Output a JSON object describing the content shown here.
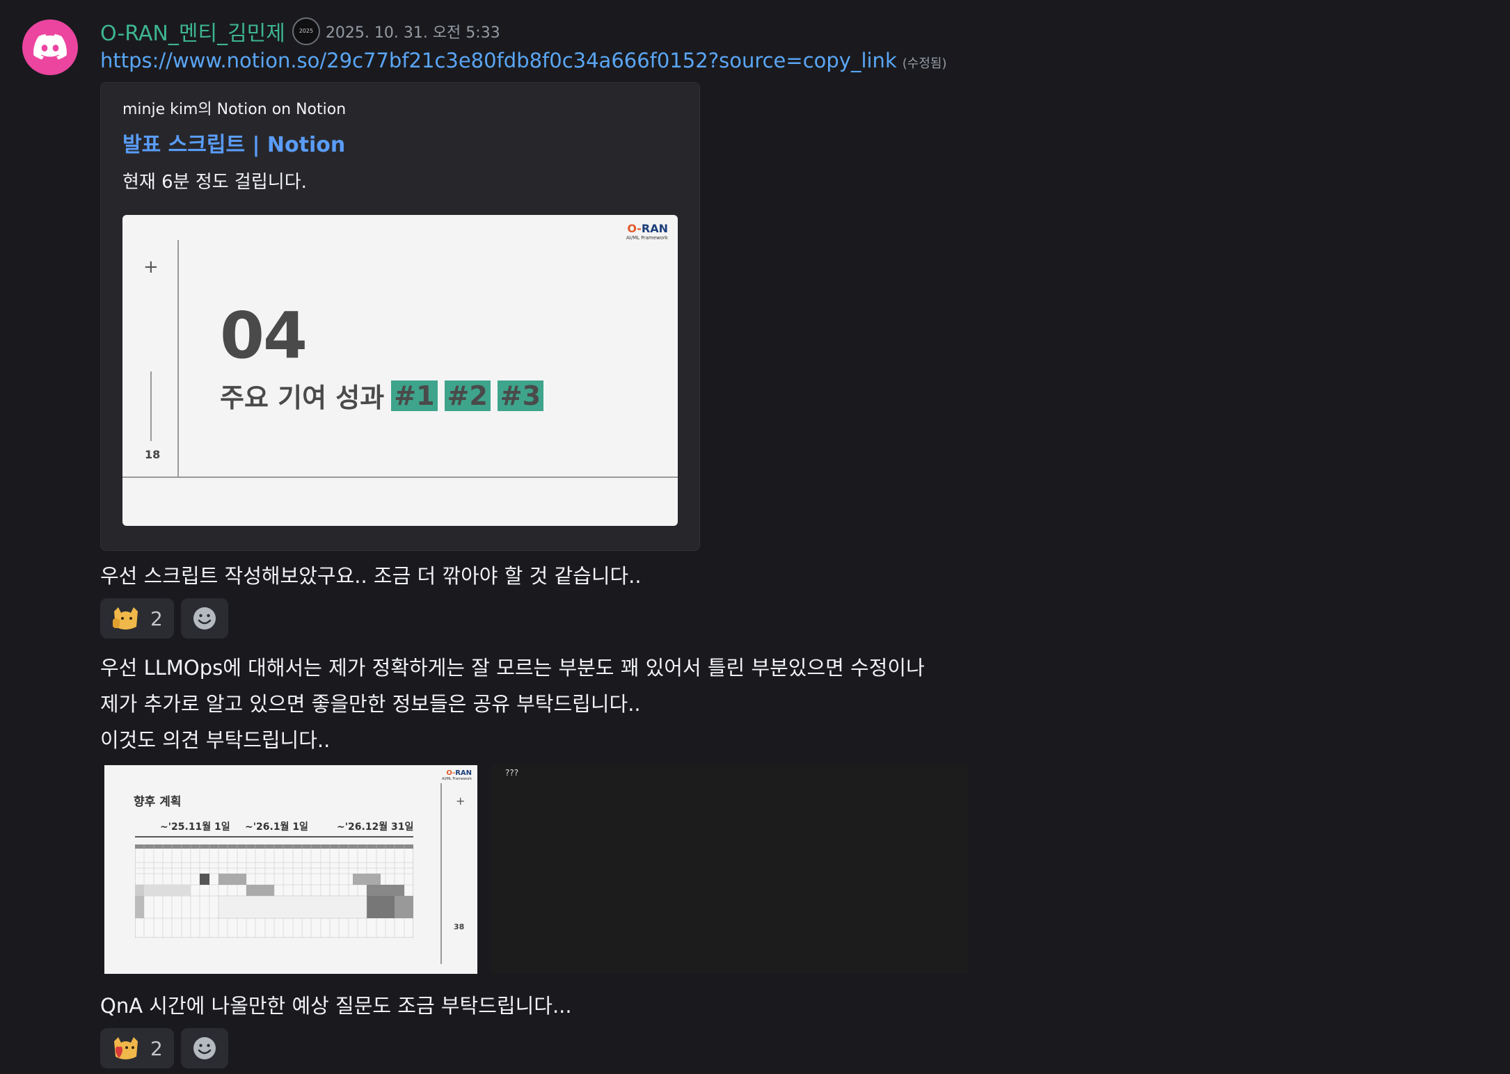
{
  "message": {
    "username": "O-RAN_멘티_김민제",
    "role_badge": "2025",
    "timestamp": "2025. 10. 31. 오전 5:33",
    "link": "https://www.notion.so/29c77bf21c3e80fdb8f0c34a666f0152?source=copy_link",
    "edited_label": "(수정됨)",
    "embed": {
      "provider": "minje kim의 Notion on Notion",
      "title": "발표 스크립트 | Notion",
      "description": "현재 6분 정도 걸립니다.",
      "slide": {
        "logo_main": "RAN",
        "logo_o": "O-",
        "logo_sub": "AI/ML Framework",
        "number": "04",
        "subtitle": "주요 기여 성과",
        "tags": [
          "#1",
          "#2",
          "#3"
        ],
        "page": "18",
        "plus": "+"
      }
    },
    "line1": "우선 스크립트 작성해보았구요.. 조금 더 깎아야 할 것 같습니다..",
    "reaction1": {
      "emoji": "cat-emoji",
      "count": "2"
    },
    "line2": "우선 LLMOps에 대해서는 제가 정확하게는 잘 모르는 부분도 꽤 있어서 틀린 부분있으면 수정이나",
    "line3": "제가 추가로 알고 있으면 좋을만한 정보들은 공유 부탁드립니다..",
    "line4": "이것도 의견 부탁드립니다..",
    "attachment": {
      "title": "향후 계획",
      "phases": [
        "~'25.11월 1일",
        "~'26.1월 1일",
        "~'26.12월 31일"
      ],
      "page": "38",
      "plus": "+",
      "logo_main": "RAN",
      "logo_o": "O-",
      "logo_sub": "AI/ML Framework",
      "second_label": "???"
    },
    "line5": "QnA 시간에 나올만한 예상 질문도 조금 부탁드립니다...",
    "reaction2": {
      "emoji": "heart-cat-emoji",
      "count": "2"
    }
  }
}
